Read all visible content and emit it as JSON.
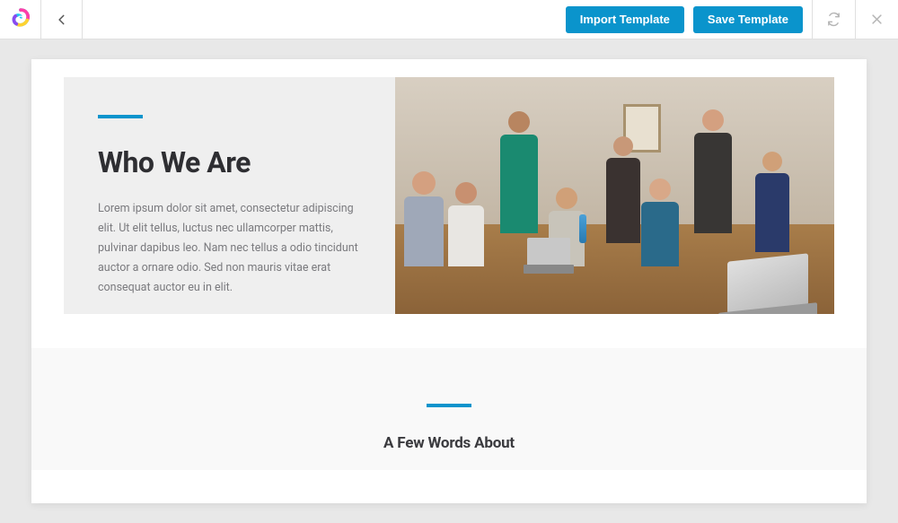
{
  "header": {
    "import_label": "Import Template",
    "save_label": "Save Template"
  },
  "hero": {
    "title": "Who We Are",
    "body": "Lorem ipsum dolor sit amet, consectetur adipiscing elit. Ut elit tellus, luctus nec ullamcorper mattis, pulvinar dapibus leo. Nam nec tellus a odio tincidunt auctor a ornare odio. Sed non mauris vitae erat consequat auctor eu in elit."
  },
  "section2": {
    "title": "A Few Words About"
  },
  "colors": {
    "primary": "#0a94cc"
  }
}
